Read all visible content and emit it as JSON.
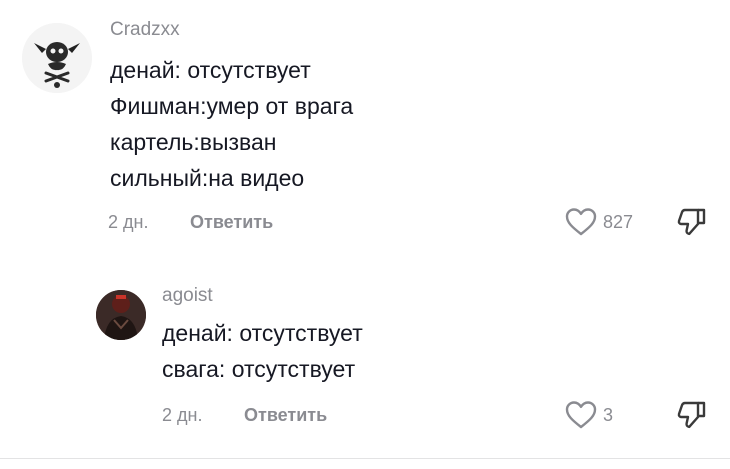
{
  "comments": [
    {
      "username": "Cradzxx",
      "lines": [
        "денай: отсутствует",
        "Фишман:умер от врага",
        "картель:вызван",
        "сильный:на видео"
      ],
      "time": "2 дн.",
      "reply_label": "Ответить",
      "likes": "827"
    },
    {
      "username": "agoist",
      "lines": [
        "денай: отсутствует",
        "свага: отсутствует"
      ],
      "time": "2 дн.",
      "reply_label": "Ответить",
      "likes": "3"
    }
  ],
  "icons": {
    "like": "heart-outline-icon",
    "dislike": "thumbs-down-icon"
  },
  "colors": {
    "text": "#161823",
    "secondary": "#8a8b91",
    "divider": "#e3e3e4"
  }
}
